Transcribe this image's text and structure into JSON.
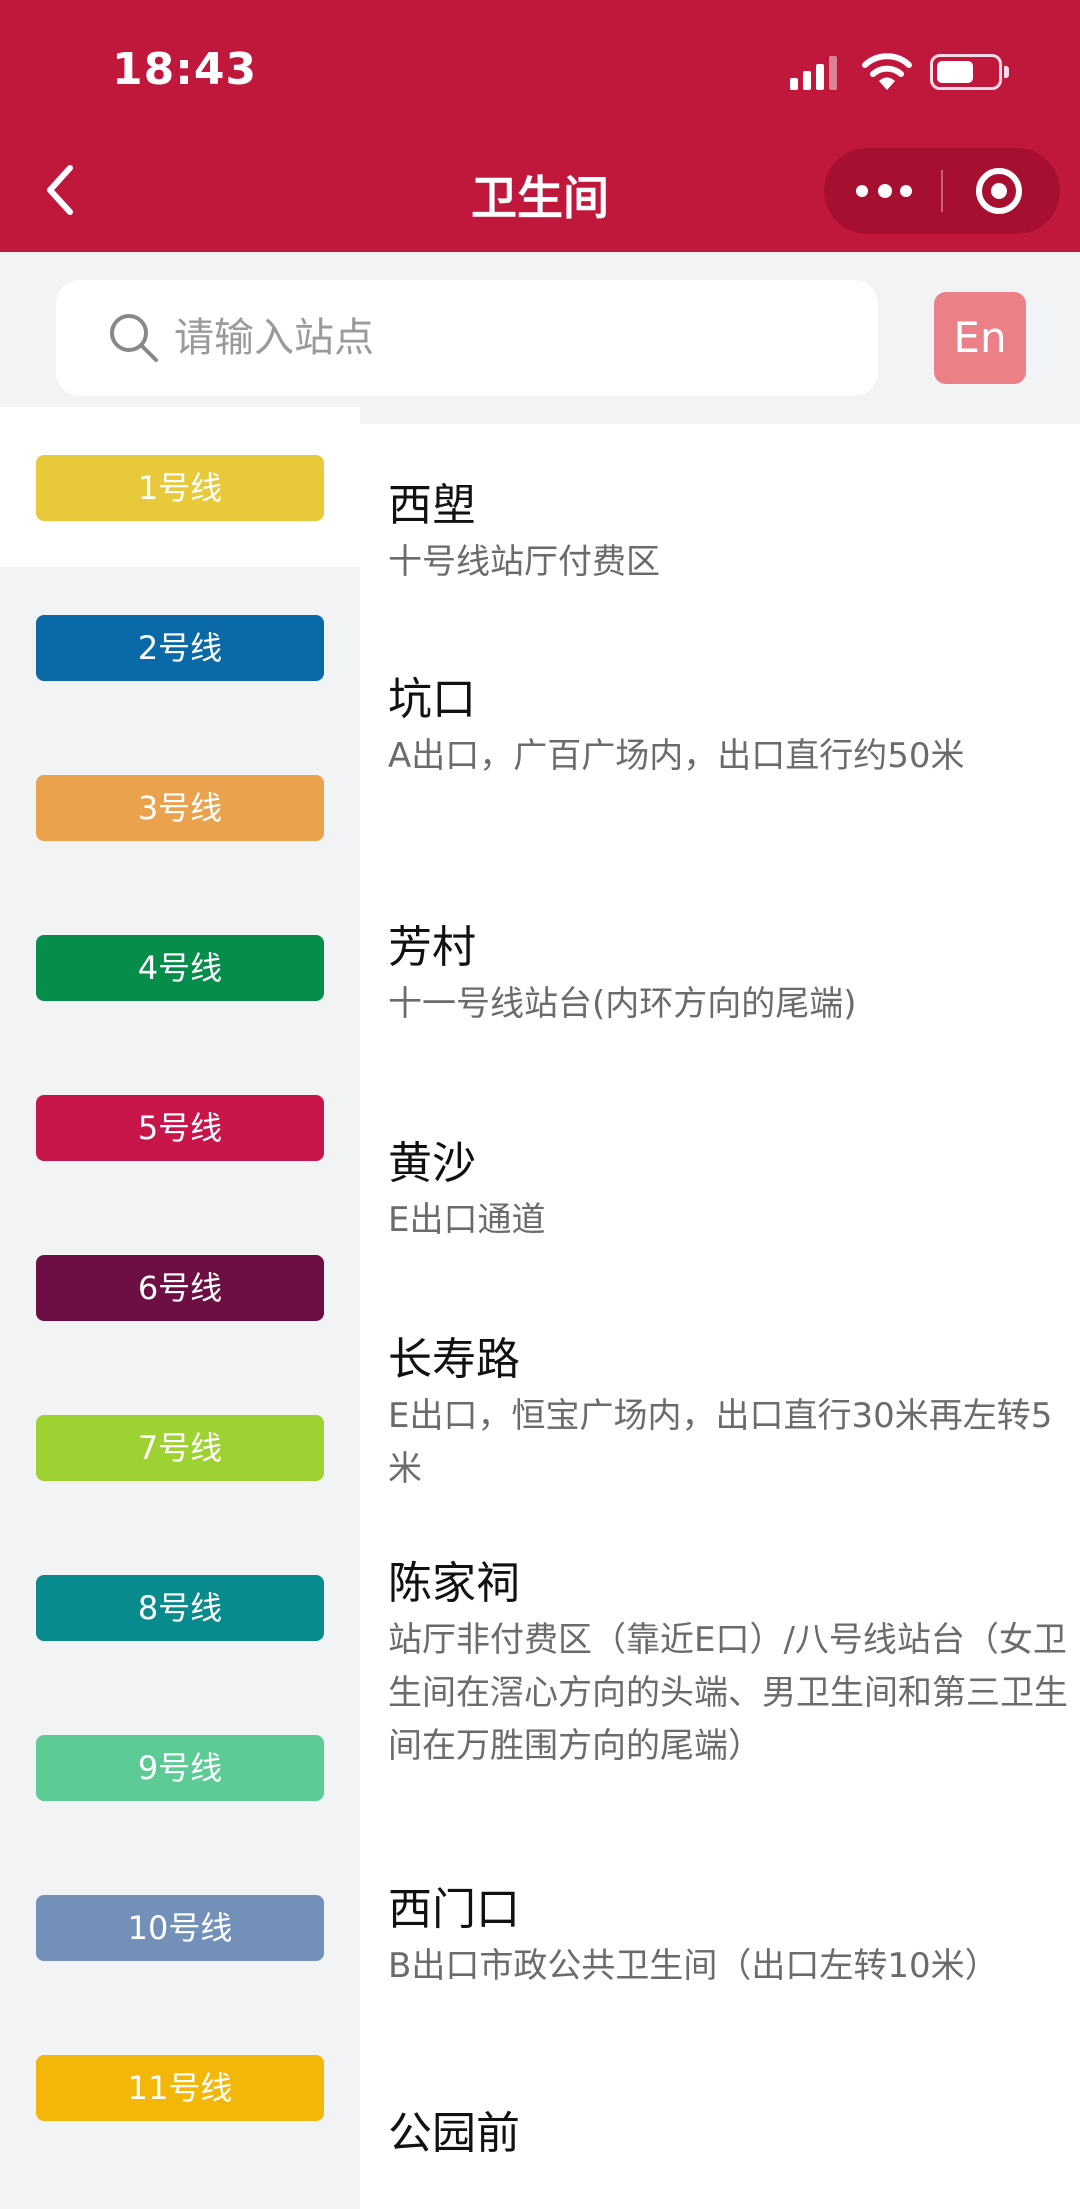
{
  "status_bar": {
    "time": "18:43"
  },
  "header": {
    "title": "卫生间"
  },
  "search": {
    "placeholder": "请输入站点",
    "lang_label": "En"
  },
  "lines": [
    {
      "label": "1号线",
      "color": "#e8c939",
      "active": true
    },
    {
      "label": "2号线",
      "color": "#0a6aa7",
      "active": false
    },
    {
      "label": "3号线",
      "color": "#eba24c",
      "active": false
    },
    {
      "label": "4号线",
      "color": "#078d4b",
      "active": false
    },
    {
      "label": "5号线",
      "color": "#c8154a",
      "active": false
    },
    {
      "label": "6号线",
      "color": "#6e0f43",
      "active": false
    },
    {
      "label": "7号线",
      "color": "#9dd232",
      "active": false
    },
    {
      "label": "8号线",
      "color": "#098a8c",
      "active": false
    },
    {
      "label": "9号线",
      "color": "#5ccb96",
      "active": false
    },
    {
      "label": "10号线",
      "color": "#7390b9",
      "active": false
    },
    {
      "label": "11号线",
      "color": "#f2b708",
      "active": false
    }
  ],
  "stations": [
    {
      "name": "西塱",
      "desc": "十号线站厅付费区"
    },
    {
      "name": "坑口",
      "desc": "A出口，广百广场内，出口直行约50米"
    },
    {
      "name": "芳村",
      "desc": "十一号线站台(内环方向的尾端)"
    },
    {
      "name": "黄沙",
      "desc": "E出口通道"
    },
    {
      "name": "长寿路",
      "desc": "E出口，恒宝广场内，出口直行30米再左转5米"
    },
    {
      "name": "陈家祠",
      "desc": "站厅非付费区（靠近E口）/八号线站台（女卫生间在滘心方向的头端、男卫生间和第三卫生间在万胜围方向的尾端）"
    },
    {
      "name": "西门口",
      "desc": "B出口市政公共卫生间（出口左转10米）"
    },
    {
      "name": "公园前",
      "desc": ""
    }
  ]
}
